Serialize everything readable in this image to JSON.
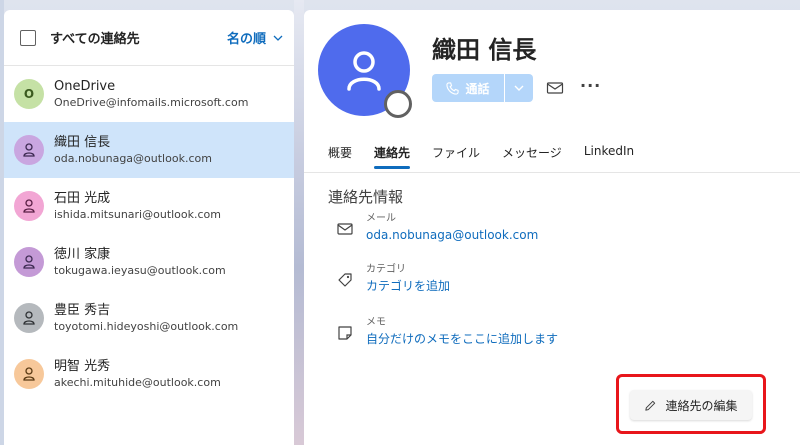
{
  "list": {
    "header_title": "すべての連絡先",
    "sort_label": "名の順",
    "contacts": [
      {
        "name": "OneDrive",
        "email": "OneDrive@infomails.microsoft.com",
        "avatar_letter": "O",
        "avatar_color": "#c5e1a5",
        "icon": "letter"
      },
      {
        "name": "織田 信長",
        "email": "oda.nobunaga@outlook.com",
        "avatar_color": "#c9a6e0",
        "icon": "person-icon"
      },
      {
        "name": "石田 光成",
        "email": "ishida.mitsunari@outlook.com",
        "avatar_color": "#f2a6d4",
        "icon": "person-icon"
      },
      {
        "name": "徳川 家康",
        "email": "tokugawa.ieyasu@outlook.com",
        "avatar_color": "#c49ad6",
        "icon": "person-icon"
      },
      {
        "name": "豊臣 秀吉",
        "email": "toyotomi.hideyoshi@outlook.com",
        "avatar_color": "#b5b9bd",
        "icon": "person-icon"
      },
      {
        "name": "明智 光秀",
        "email": "akechi.mituhide@outlook.com",
        "avatar_color": "#f7c89a",
        "icon": "person-icon"
      }
    ]
  },
  "detail": {
    "name": "織田 信長",
    "avatar_color": "#4f6bed",
    "call_label": "通話",
    "more_label": "···",
    "tabs": [
      "概要",
      "連絡先",
      "ファイル",
      "メッセージ",
      "LinkedIn"
    ],
    "active_tab": "連絡先",
    "section_title": "連絡先情報",
    "fields": [
      {
        "label": "メール",
        "value": "oda.nobunaga@outlook.com",
        "icon": "mail-icon"
      },
      {
        "label": "カテゴリ",
        "value": "カテゴリを追加",
        "icon": "tag-icon"
      },
      {
        "label": "メモ",
        "value": "自分だけのメモをここに追加します",
        "icon": "note-icon"
      }
    ],
    "edit_label": "連絡先の編集"
  },
  "colors": {
    "accent": "#0f6cbd",
    "selected_row": "#cfe4fa",
    "highlight_border": "#e8161b"
  }
}
